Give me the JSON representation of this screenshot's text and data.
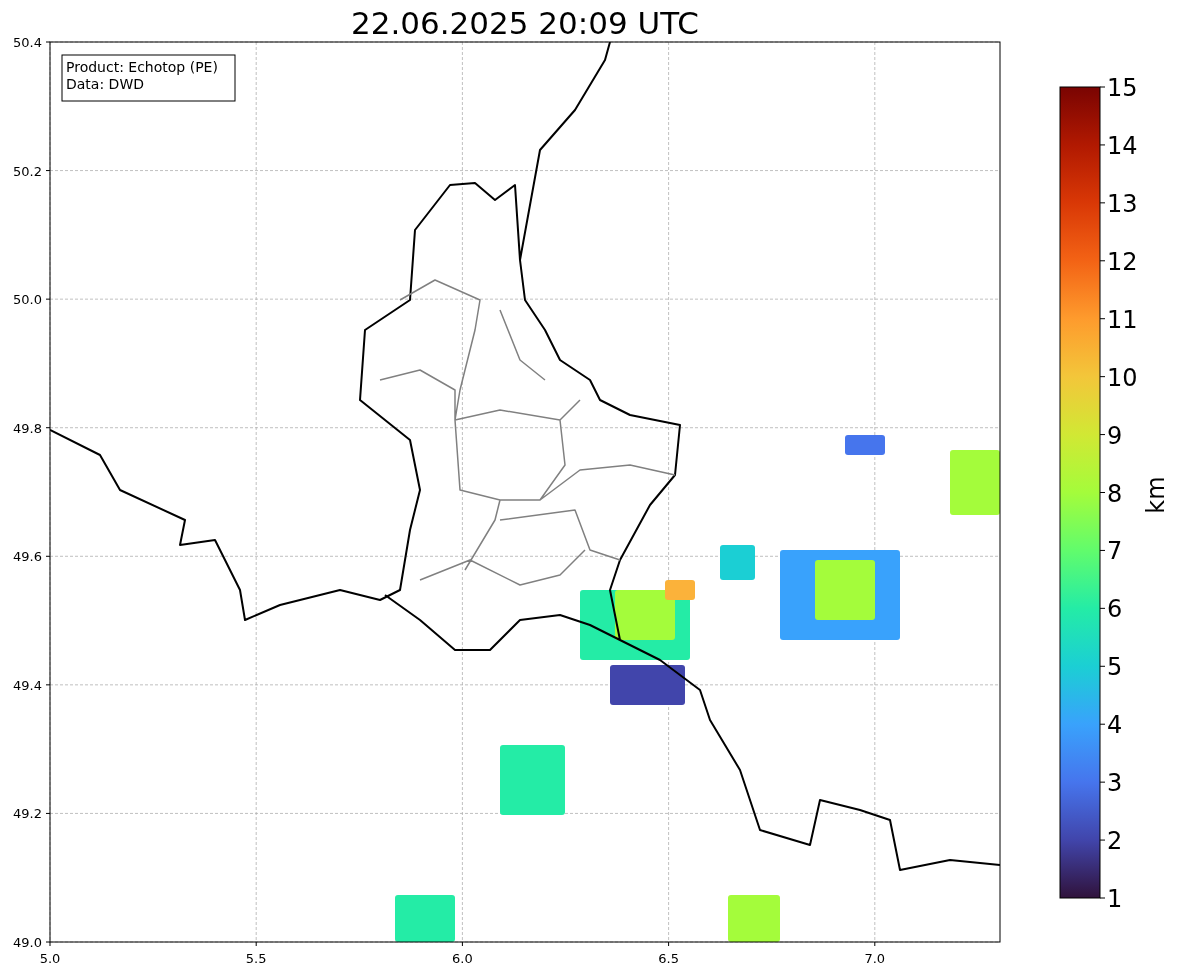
{
  "title": "22.06.2025 20:09 UTC",
  "legend": [
    "Product: Echotop (PE)",
    "Data: DWD"
  ],
  "xticks": [
    "5.0",
    "5.5",
    "6.0",
    "6.5",
    "7.0"
  ],
  "yticks": [
    "50.4",
    "50.2",
    "50.0",
    "49.8",
    "49.6",
    "49.4",
    "49.2",
    "49.0"
  ],
  "colorbar": {
    "label": "km",
    "ticks": [
      "15",
      "14",
      "13",
      "12",
      "11",
      "10",
      "9",
      "8",
      "7",
      "6",
      "5",
      "4",
      "3",
      "2",
      "1"
    ]
  }
}
